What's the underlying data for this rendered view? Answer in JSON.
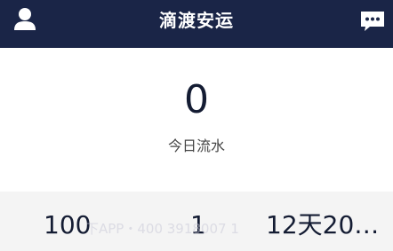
{
  "header": {
    "title": "滴渡安运",
    "user_icon": "user-icon",
    "message_icon": "chat-bubble-icon",
    "background_color": "#1a2547"
  },
  "summary": {
    "value": "0",
    "label": "今日流水"
  },
  "stats": [
    {
      "value": "100"
    },
    {
      "value": "1"
    },
    {
      "value": "12天20小..."
    }
  ],
  "watermark": "下APP・400 3918007 1"
}
